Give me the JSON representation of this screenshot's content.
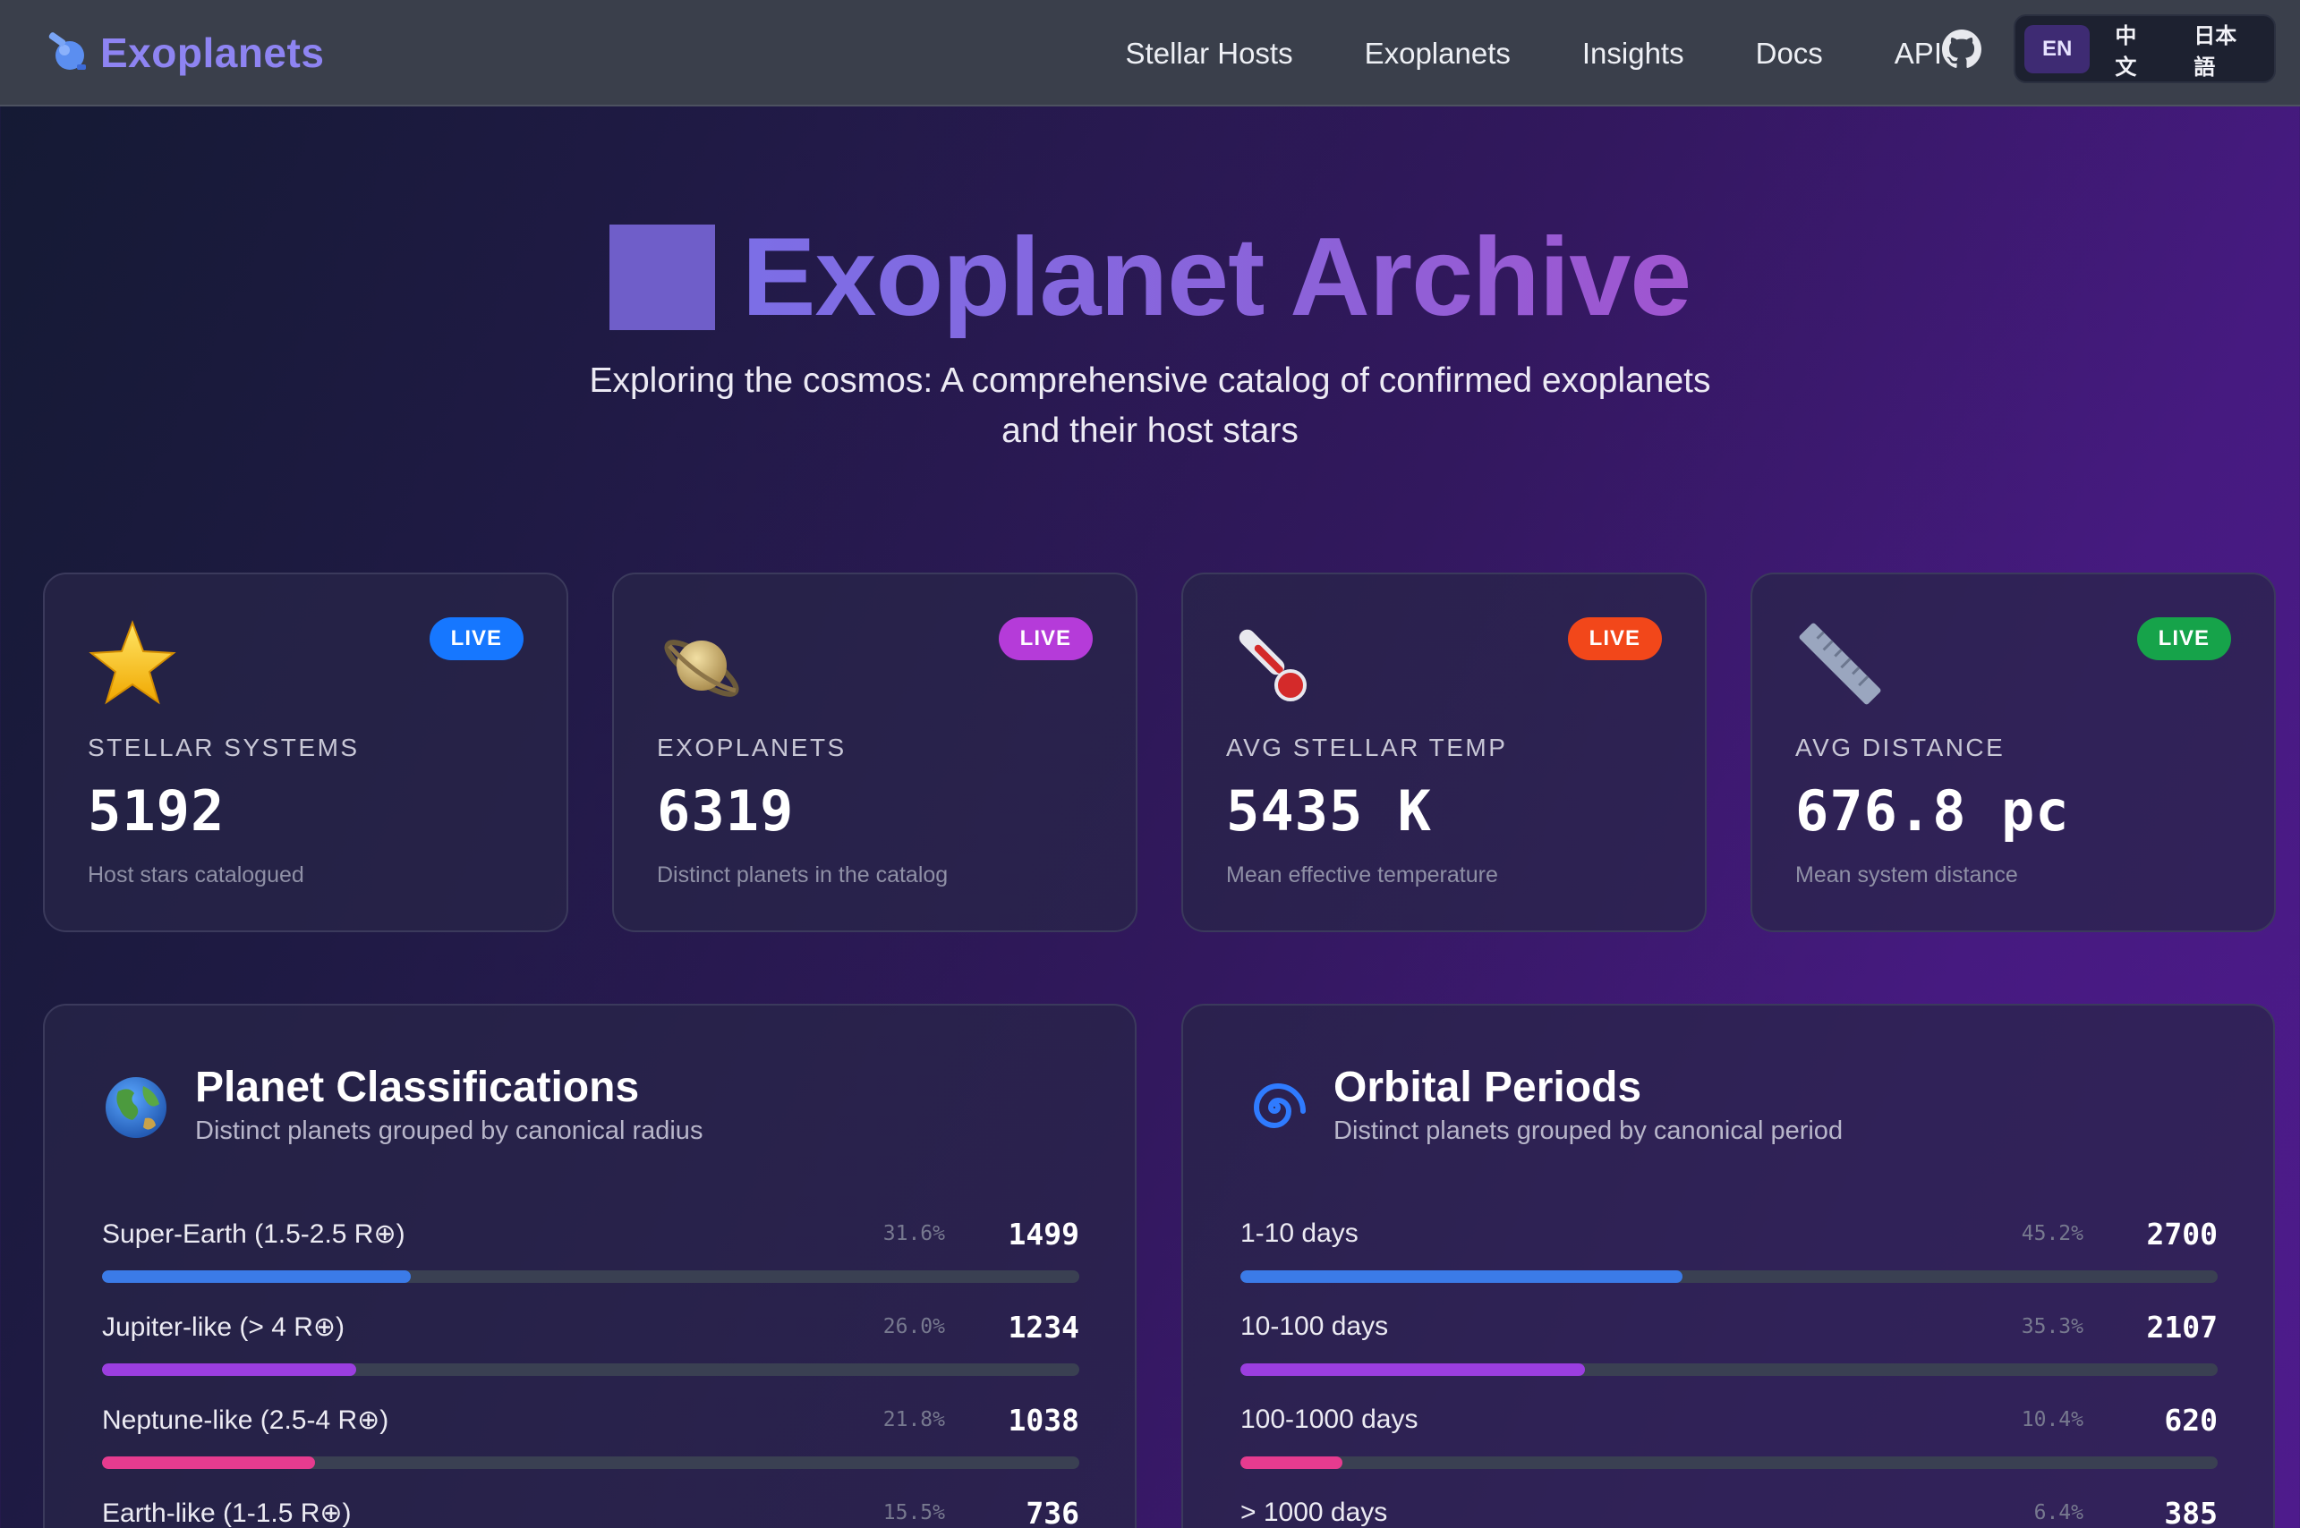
{
  "nav": {
    "brand": "Exoplanets",
    "links": [
      "Stellar Hosts",
      "Exoplanets",
      "Insights",
      "Docs",
      "API"
    ],
    "github_icon": "github-icon",
    "languages": [
      "EN",
      "中文",
      "日本語"
    ],
    "active_language": "EN"
  },
  "hero": {
    "title": "Exoplanet Archive",
    "subtitle_line1": "Exploring the cosmos: A comprehensive catalog of confirmed exoplanets",
    "subtitle_line2": "and their host stars"
  },
  "stats": [
    {
      "icon": "star-icon",
      "badge": "LIVE",
      "badge_color": "#1677ff",
      "label": "STELLAR SYSTEMS",
      "value": "5192",
      "desc": "Host stars catalogued"
    },
    {
      "icon": "ringed-planet-icon",
      "badge": "LIVE",
      "badge_color": "#b53bd9",
      "label": "EXOPLANETS",
      "value": "6319",
      "desc": "Distinct planets in the catalog"
    },
    {
      "icon": "thermometer-icon",
      "badge": "LIVE",
      "badge_color": "#f2471a",
      "label": "AVG STELLAR TEMP",
      "value": "5435 K",
      "desc": "Mean effective temperature"
    },
    {
      "icon": "ruler-icon",
      "badge": "LIVE",
      "badge_color": "#16a34a",
      "label": "AVG DISTANCE",
      "value": "676.8 pc",
      "desc": "Mean system distance"
    }
  ],
  "classifications": {
    "icon": "globe-icon",
    "title": "Planet Classifications",
    "subtitle": "Distinct planets grouped by canonical radius",
    "rows": [
      {
        "label": "Super-Earth (1.5-2.5 R⊕)",
        "pct": "31.6%",
        "count": "1499",
        "fraction": 0.316,
        "color": "#3b7be8"
      },
      {
        "label": "Jupiter-like (> 4 R⊕)",
        "pct": "26.0%",
        "count": "1234",
        "fraction": 0.26,
        "color": "#9b3ee0"
      },
      {
        "label": "Neptune-like (2.5-4 R⊕)",
        "pct": "21.8%",
        "count": "1038",
        "fraction": 0.218,
        "color": "#e63b8f"
      },
      {
        "label": "Earth-like (1-1.5 R⊕)",
        "pct": "15.5%",
        "count": "736",
        "fraction": 0.155,
        "color": "#f59e0b"
      }
    ]
  },
  "periods": {
    "icon": "spiral-galaxy-icon",
    "title": "Orbital Periods",
    "subtitle": "Distinct planets grouped by canonical period",
    "rows": [
      {
        "label": "1-10 days",
        "pct": "45.2%",
        "count": "2700",
        "fraction": 0.452,
        "color": "#3b7be8"
      },
      {
        "label": "10-100 days",
        "pct": "35.3%",
        "count": "2107",
        "fraction": 0.353,
        "color": "#9b3ee0"
      },
      {
        "label": "100-1000 days",
        "pct": "10.4%",
        "count": "620",
        "fraction": 0.104,
        "color": "#e63b8f"
      },
      {
        "label": "> 1000 days",
        "pct": "6.4%",
        "count": "385",
        "fraction": 0.064,
        "color": "#f59e0b"
      }
    ]
  }
}
